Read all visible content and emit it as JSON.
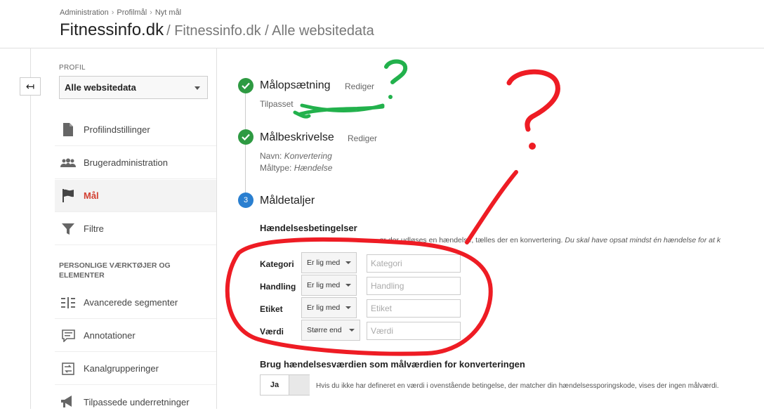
{
  "header": {
    "breadcrumb": [
      "Administration",
      "Profilmål",
      "Nyt mål"
    ],
    "title": "Fitnessinfo.dk",
    "subtitle": "/ Fitnessinfo.dk / Alle websitedata"
  },
  "rail": {
    "back_icon": "↤"
  },
  "sidebar": {
    "profile_label": "PROFIL",
    "profile_value": "Alle websitedata",
    "items": [
      {
        "label": "Profilindstillinger",
        "icon": "document-icon"
      },
      {
        "label": "Brugeradministration",
        "icon": "users-icon"
      },
      {
        "label": "Mål",
        "icon": "flag-icon",
        "active": true
      },
      {
        "label": "Filtre",
        "icon": "filter-icon"
      }
    ],
    "section_label": "PERSONLIGE VÆRKTØJER OG ELEMENTER",
    "tools": [
      {
        "label": "Avancerede segmenter",
        "icon": "segments-icon"
      },
      {
        "label": "Annotationer",
        "icon": "annotation-icon"
      },
      {
        "label": "Kanalgrupperinger",
        "icon": "channel-icon"
      },
      {
        "label": "Tilpassede underretninger",
        "icon": "megaphone-icon"
      }
    ]
  },
  "steps": {
    "step1": {
      "title": "Målopsætning",
      "edit": "Rediger",
      "info": "Tilpasset"
    },
    "step2": {
      "title": "Målbeskrivelse",
      "edit": "Rediger",
      "name_label": "Navn:",
      "name_value": "Konvertering",
      "type_label": "Måltype:",
      "type_value": "Hændelse"
    },
    "step3": {
      "number": "3",
      "title": "Måldetaljer"
    }
  },
  "conditions": {
    "heading": "Hændelsesbetingelser",
    "description": "ør der udløses en hændelse, tælles der en konvertering.",
    "description_italic": "Du skal have opsat mindst én hændelse for at k",
    "rows": [
      {
        "label": "Kategori",
        "operator": "Er lig med",
        "placeholder": "Kategori"
      },
      {
        "label": "Handling",
        "operator": "Er lig med",
        "placeholder": "Handling"
      },
      {
        "label": "Etiket",
        "operator": "Er lig med",
        "placeholder": "Etiket"
      },
      {
        "label": "Værdi",
        "operator": "Større end",
        "placeholder": "Værdi"
      }
    ]
  },
  "use_value": {
    "heading": "Brug hændelsesværdien som målværdien for konverteringen",
    "toggle_label": "Ja",
    "note": "Hvis du ikke har defineret en værdi i ovenstående betingelse, der matcher din hændelsessporingskode, vises der ingen målværdi."
  },
  "colors": {
    "accent_red": "#d23f31",
    "check_green": "#2e9a42",
    "step_blue": "#2a7fd0",
    "annotation_red": "#ee1c24",
    "annotation_green": "#22b14c"
  }
}
